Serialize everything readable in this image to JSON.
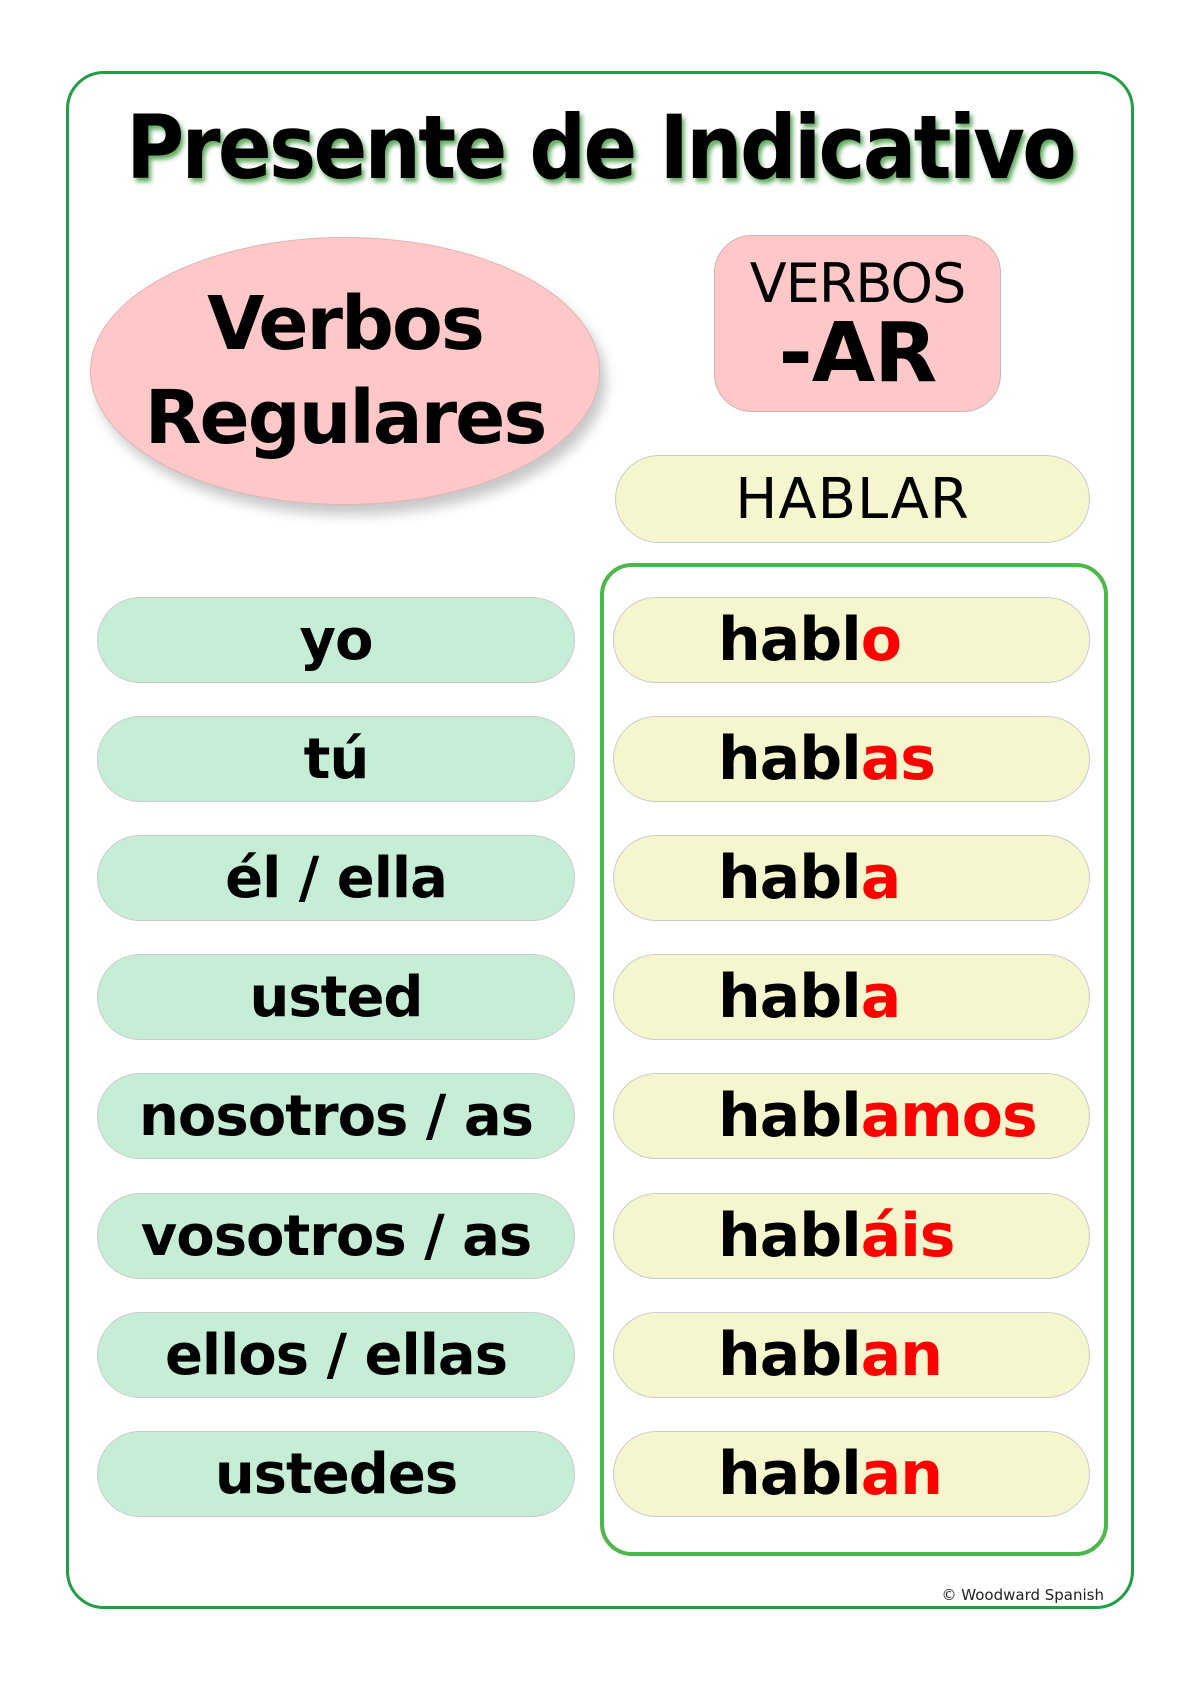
{
  "title": "Presente de Indicativo",
  "category": {
    "line1": "Verbos",
    "line2": "Regulares"
  },
  "verb_group": {
    "line1": "VERBOS",
    "line2": "-AR"
  },
  "infinitive": "HABLAR",
  "conjugations": [
    {
      "pronoun": "yo",
      "stem": "habl",
      "ending": "o"
    },
    {
      "pronoun": "tú",
      "stem": "habl",
      "ending": "as"
    },
    {
      "pronoun": "él / ella",
      "stem": "habl",
      "ending": "a"
    },
    {
      "pronoun": "usted",
      "stem": "habl",
      "ending": "a"
    },
    {
      "pronoun": "nosotros / as",
      "stem": "habl",
      "ending": "amos"
    },
    {
      "pronoun": "vosotros / as",
      "stem": "habl",
      "ending": "áis"
    },
    {
      "pronoun": "ellos / ellas",
      "stem": "habl",
      "ending": "an"
    },
    {
      "pronoun": "ustedes",
      "stem": "habl",
      "ending": "an"
    }
  ],
  "colors": {
    "frame": "#1f9e46",
    "conjugation_frame": "#4cb84c",
    "pink": "#ffc8c8",
    "pronoun_fill": "#c6eed6",
    "verb_fill": "#f5f6cd",
    "ending": "#ff0000"
  },
  "copyright": "© Woodward Spanish"
}
